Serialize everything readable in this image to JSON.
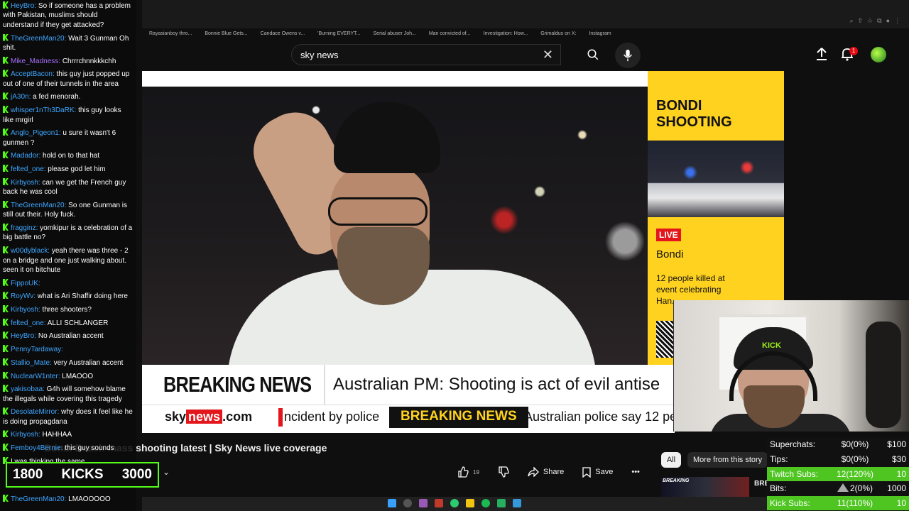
{
  "browser": {
    "bookmarks": [
      "Rayasianboy thro...",
      "Bonnie Blue Gets...",
      "Candace Owens v...",
      "'Burning EVERYT...",
      "Serial abuser Joh...",
      "Man convicted of...",
      "Investigation: How...",
      "Grimaldus on X:",
      "Instagram"
    ]
  },
  "youtube": {
    "search_value": "sky news",
    "notifications_count": "1",
    "video_title": "Bondi Beach mass shooting latest | Sky News live coverage",
    "like_count": "19",
    "actions": {
      "share": "Share",
      "save": "Save"
    },
    "chips": {
      "all": "All",
      "more": "More from this story"
    },
    "recommended": {
      "thumb_label": "BREAKING",
      "label": "BRE"
    }
  },
  "broadcast": {
    "side_title": "BONDI SHOOTING",
    "live_badge": "LIVE",
    "live_place": "Bondi",
    "live_desc": "12 people killed at event celebrating Han...",
    "banner_label": "BREAKING NEWS",
    "banner_headline": "Australian PM: Shooting is act of evil antise",
    "ticker_brand_sky": "sky",
    "ticker_brand_news": "news",
    "ticker_brand_com": ".com",
    "ticker_item1": "ncident by police",
    "ticker_bn": "BREAKING NEWS",
    "ticker_item2": "Australian police say 12 peo",
    "cap_logo": "KICK"
  },
  "chat": [
    {
      "user": "HeyBro",
      "color": "#3ea6ff",
      "text": "So if someone has a problem with Pakistan, muslims should understand if they get attacked?"
    },
    {
      "user": "TheGreenMan20",
      "color": "#3ea6ff",
      "text": "Wait 3 Gunman Oh shit."
    },
    {
      "user": "Mike_Madness",
      "color": "#a970ff",
      "text": "Chrrrchnnkkkchh"
    },
    {
      "user": "AcceptBacon",
      "color": "#3ea6ff",
      "text": "this guy just popped up out of one of their tunnels in the area"
    },
    {
      "user": "jA30n",
      "color": "#3ea6ff",
      "text": "a fed menorah."
    },
    {
      "user": "whisper1nTh3DaRK",
      "color": "#3ea6ff",
      "text": "this guy looks like mrgirl"
    },
    {
      "user": "Anglo_Pigeon1",
      "color": "#3ea6ff",
      "text": "u sure it wasn't 6 gunmen ?"
    },
    {
      "user": "Madador",
      "color": "#3ea6ff",
      "text": "hold on to that hat"
    },
    {
      "user": "felted_one",
      "color": "#3ea6ff",
      "text": "please god let him"
    },
    {
      "user": "Kirbyosh",
      "color": "#3ea6ff",
      "text": "can we get the French guy back he was cool"
    },
    {
      "user": "TheGreenMan20",
      "color": "#3ea6ff",
      "text": "So one Gunman is still out their. Holy fuck."
    },
    {
      "user": "fragginz",
      "color": "#3ea6ff",
      "text": "yomkipur is a celebration of a big battle no?"
    },
    {
      "user": "w00dyblack",
      "color": "#3ea6ff",
      "text": "yeah there was three - 2 on a bridge and one just walking about. seen it on bitchute"
    },
    {
      "user": "FippoUK",
      "color": "#3ea6ff",
      "text": ""
    },
    {
      "user": "RoyWv",
      "color": "#3ea6ff",
      "text": "what is Ari Shaffir doing here"
    },
    {
      "user": "Kirbyosh",
      "color": "#3ea6ff",
      "text": "three shooters?"
    },
    {
      "user": "felted_one",
      "color": "#3ea6ff",
      "text": "ALLI SCHLANGER"
    },
    {
      "user": "HeyBro",
      "color": "#3ea6ff",
      "text": "No Australian accent"
    },
    {
      "user": "PennyTardaway",
      "color": "#3ea6ff",
      "text": ""
    },
    {
      "user": "Stallio_Mate",
      "color": "#3ea6ff",
      "text": "very Australian accent"
    },
    {
      "user": "NuclearW1nter",
      "color": "#3ea6ff",
      "text": "LMAOOO"
    },
    {
      "user": "yakisobaa",
      "color": "#3ea6ff",
      "text": "G4h will somehow blame the illegals while covering this tragedy"
    },
    {
      "user": "DesolateMirror",
      "color": "#3ea6ff",
      "text": "why does it feel like he is doing propagdana"
    },
    {
      "user": "Kirbyosh",
      "color": "#3ea6ff",
      "text": "HAHHAA"
    },
    {
      "user": "Femboy4Bernie",
      "color": "#3ea6ff",
      "text": "this guy sounds"
    },
    {
      "user": "",
      "color": "#3ea6ff",
      "text": "I was thinking the same"
    }
  ],
  "chat_last": {
    "user": "TheGreenMan20",
    "text": "LMAOOOOO"
  },
  "kicks": {
    "current": "1800",
    "label": "KICKS",
    "goal": "3000"
  },
  "stats": [
    {
      "label": "Superchats:",
      "value": "$0(0%)",
      "goal": "$100",
      "green": false
    },
    {
      "label": "Tips:",
      "value": "$0(0%)",
      "goal": "$30",
      "green": false
    },
    {
      "label": "Twitch Subs:",
      "value": "12(120%)",
      "goal": "10",
      "green": true
    },
    {
      "label": "Bits:",
      "value": "2(0%)",
      "goal": "1000",
      "green": false
    },
    {
      "label": "Kick Subs:",
      "value": "11(110%)",
      "goal": "10",
      "green": true
    }
  ]
}
